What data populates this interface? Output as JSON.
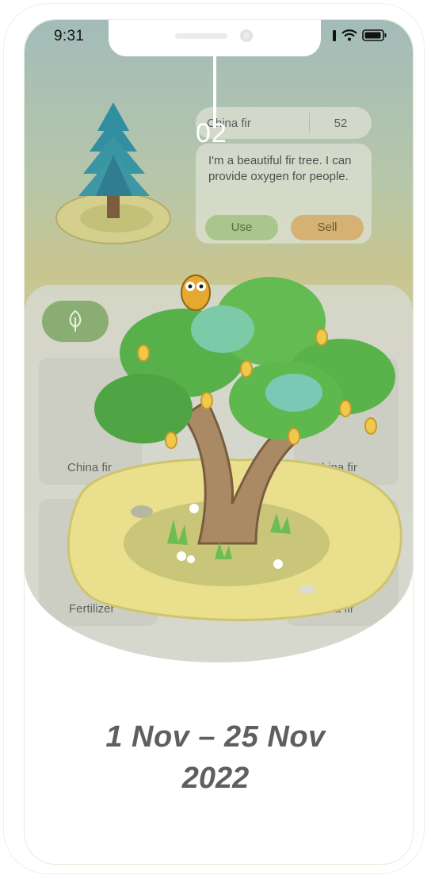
{
  "status": {
    "time": "9:31"
  },
  "marker": {
    "number": "02"
  },
  "item_detail": {
    "name": "China fir",
    "quantity": "52",
    "description": "I'm a beautiful fir tree. I can provide oxygen for people.",
    "use_label": "Use",
    "sell_label": "Sell"
  },
  "inventory": {
    "items": [
      {
        "label": "China fir"
      },
      {
        "label": "China fir"
      },
      {
        "label": "Fertilizer"
      },
      {
        "label": "China fir"
      }
    ]
  },
  "dates": {
    "line1": "1 Nov – 25 Nov",
    "line2": "2022"
  },
  "colors": {
    "accent_green": "#8aad74",
    "sell_orange": "#d5b274",
    "use_green": "#aac58d"
  }
}
